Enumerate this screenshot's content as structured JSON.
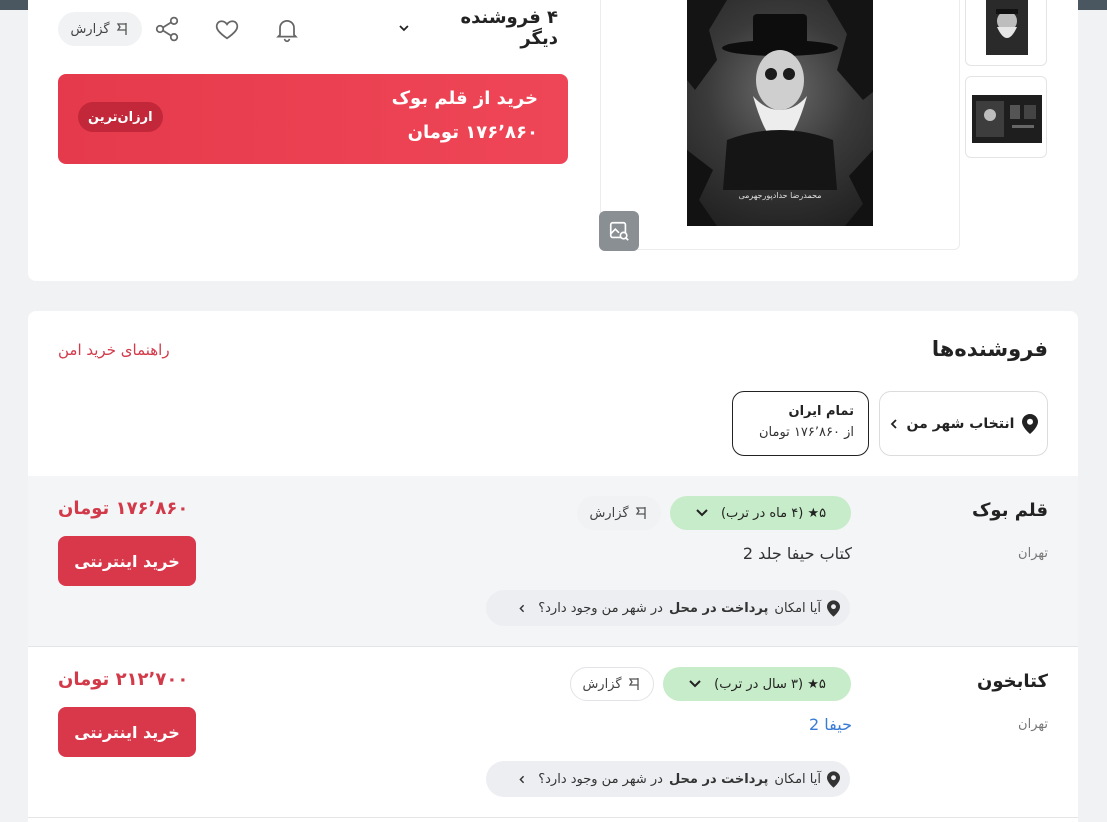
{
  "product": {
    "other_sellers_label": "۴ فروشنده دیگر",
    "report_label": "گزارش",
    "buy_banner": {
      "line1": "خرید از قلم بوک",
      "line2": "۱۷۶٬۸۶۰ تومان",
      "badge": "ارزان‌ترین"
    },
    "cover_author": "محمدرضا حدادپورجهرمی"
  },
  "sellers_section": {
    "title": "فروشنده‌ها",
    "guide_link": "راهنمای خرید امن",
    "city_select_label": "انتخاب شهر من",
    "region_chip": {
      "name": "تمام ایران",
      "price": "از ۱۷۶٬۸۶۰ تومان"
    },
    "rows": [
      {
        "shop_name": "قلم بوک",
        "city": "تهران",
        "rating": "۵★ (۴ ماه در ترب)",
        "report_label": "گزارش",
        "title": "کتاب حیفا جلد 2",
        "cod_prefix": "آیا امکان",
        "cod_bold": "پرداخت در محل",
        "cod_suffix": "در شهر من وجود دارد؟",
        "price": "۱۷۶٬۸۶۰ تومان",
        "buy_label": "خرید اینترنتی"
      },
      {
        "shop_name": "کتابخون",
        "city": "تهران",
        "rating": "۵★ (۳ سال در ترب)",
        "report_label": "گزارش",
        "title": "حیفا 2",
        "cod_prefix": "آیا امکان",
        "cod_bold": "پرداخت در محل",
        "cod_suffix": "در شهر من وجود دارد؟",
        "price": "۲۱۲٬۷۰۰ تومان",
        "buy_label": "خرید اینترنتی"
      }
    ]
  },
  "colors": {
    "accent_red": "#d8384a",
    "rating_green": "#c7ecc9",
    "link_blue": "#3a7bd5"
  }
}
